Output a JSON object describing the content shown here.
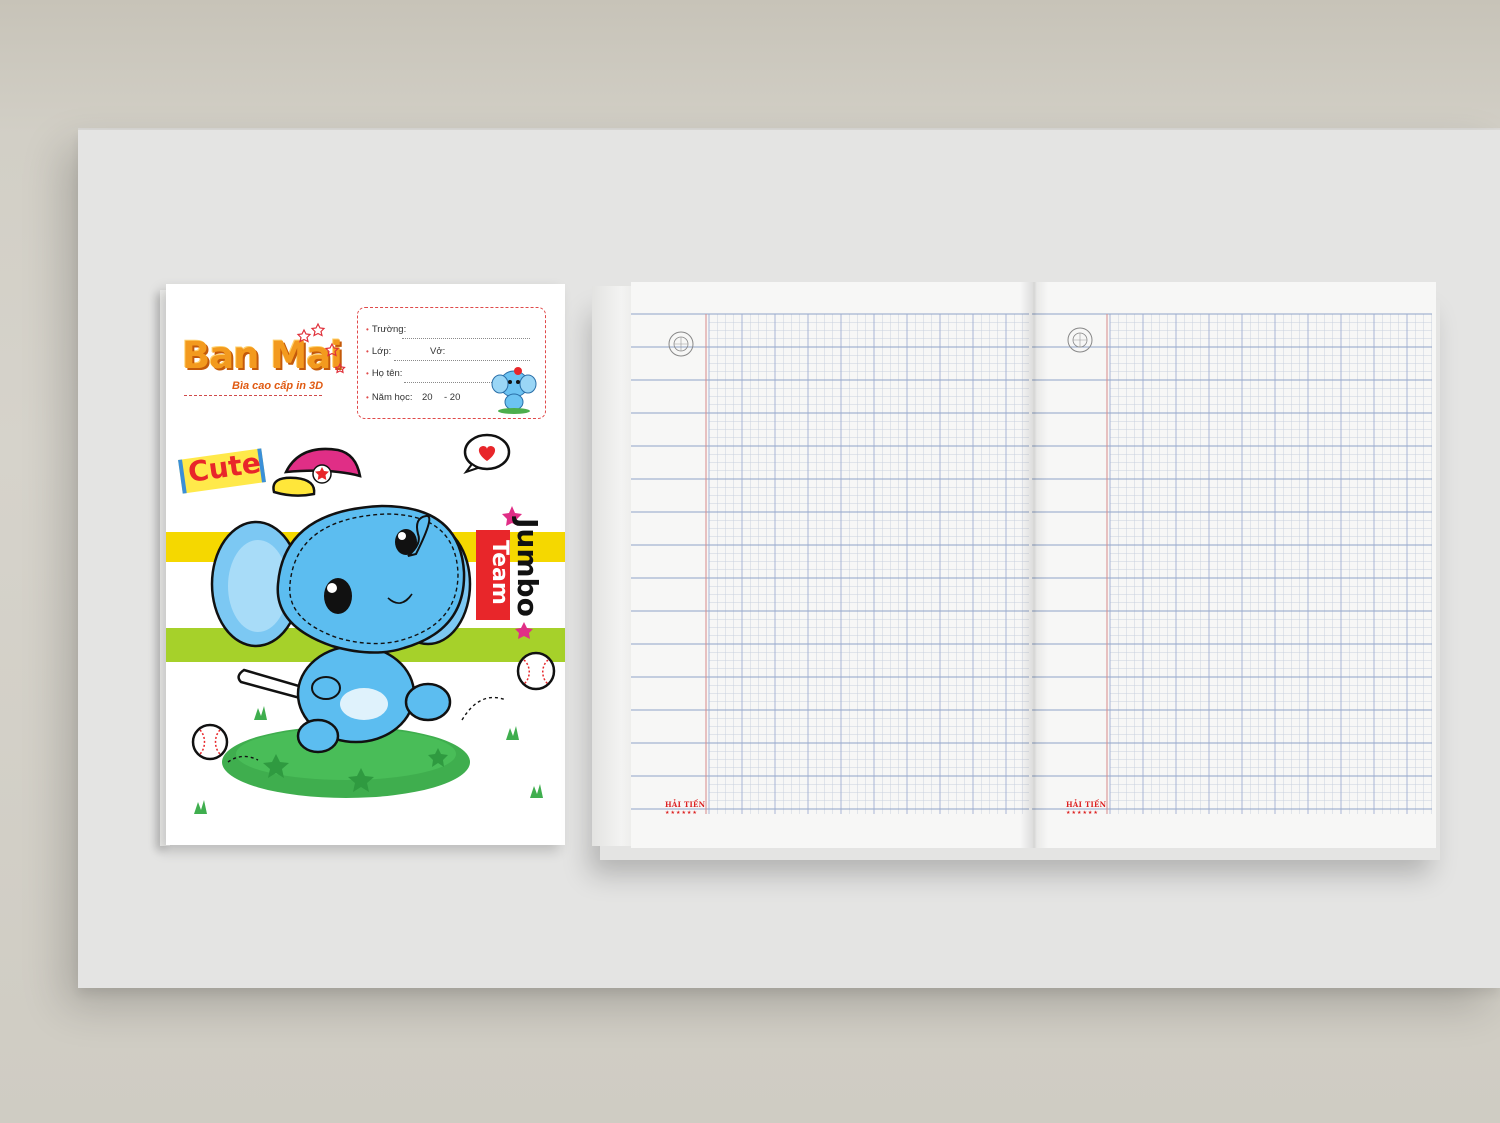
{
  "cover": {
    "brand_name": "Ban Mai",
    "tagline": "Bìa cao cấp in 3D",
    "label_fields": {
      "school": "Trường:",
      "class": "Lớp:",
      "notebook": "Vở:",
      "name": "Họ tên:",
      "school_year": "Năm học:",
      "year_from": "20",
      "year_to": "- 20"
    },
    "sticker_cute": "Cute",
    "sticker_jumbo": "Jumbo",
    "sticker_team": "Team"
  },
  "notebook": {
    "maker_left": "HẢI TIẾN",
    "maker_right": "HẢI TIẾN",
    "maker_stars": "★★★★★★"
  },
  "colors": {
    "brand_orange": "#f39a1e",
    "elephant_blue": "#4fb3ef",
    "stripe_yellow": "#f5d800",
    "stripe_green": "#a6d12a",
    "grass_green": "#3fae4e",
    "accent_red": "#e8262a",
    "grid_blue": "#8fa3c8",
    "margin_red": "#d78a8a"
  }
}
